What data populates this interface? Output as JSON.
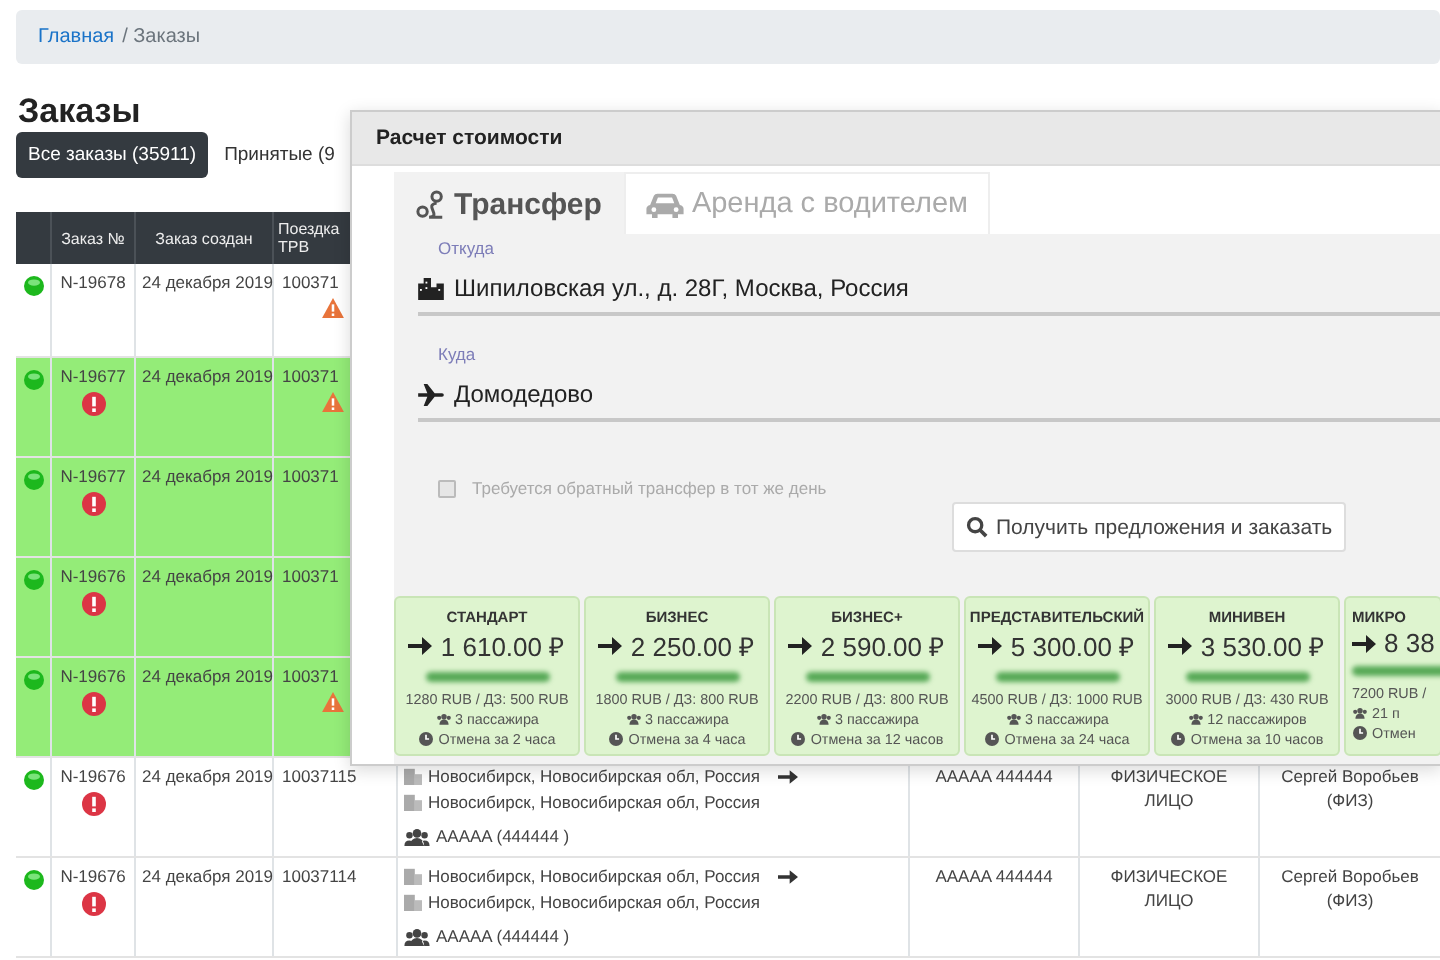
{
  "breadcrumb": [
    {
      "label": "Главная",
      "link": true
    },
    {
      "label": "/ Заказы",
      "link": false
    }
  ],
  "heading": "Заказы",
  "tabs": [
    {
      "label": "Все заказы (35911)",
      "selected": true
    },
    {
      "label": "Принятые (9",
      "selected": false
    }
  ],
  "table": {
    "columns": [
      "Заказ №",
      "Заказ создан",
      "Поездка ТРВ"
    ],
    "rows": [
      {
        "number": "N-19678",
        "date": "24 декабря 2019",
        "trip": "100371",
        "alert": false,
        "warning": true,
        "highlighted": false
      },
      {
        "number": "N-19677",
        "date": "24 декабря 2019",
        "trip": "100371",
        "alert": true,
        "warning": true,
        "highlighted": true
      },
      {
        "number": "N-19677",
        "date": "24 декабря 2019",
        "trip": "100371",
        "alert": true,
        "warning": false,
        "highlighted": true
      },
      {
        "number": "N-19676",
        "date": "24 декабря 2019",
        "trip": "100371",
        "alert": true,
        "warning": false,
        "highlighted": true
      },
      {
        "number": "N-19676",
        "date": "24 декабря 2019",
        "trip": "100371",
        "alert": true,
        "warning": true,
        "highlighted": true
      },
      {
        "number": "N-19676",
        "date": "24 декабря 2019",
        "trip": "10037115",
        "alert": true,
        "warning": false,
        "highlighted": false,
        "route": {
          "from": "Новосибирск, Новосибирская обл, Россия",
          "to": "Новосибирск, Новосибирская обл, Россия",
          "passenger": "AAAAA (444444 )"
        },
        "document": "AAAAA 444444",
        "customer_type": "ФИЗИЧЕСКОЕ ЛИЦО",
        "client": "Сергей Воробьев (ФИЗ)"
      },
      {
        "number": "N-19676",
        "date": "24 декабря 2019",
        "trip": "10037114",
        "alert": true,
        "warning": false,
        "highlighted": false,
        "route": {
          "from": "Новосибирск, Новосибирская обл, Россия",
          "to": "Новосибирск, Новосибирская обл, Россия",
          "passenger": "AAAAA (444444 )"
        },
        "document": "AAAAA 444444",
        "customer_type": "ФИЗИЧЕСКОЕ ЛИЦО",
        "client": "Сергей Воробьев (ФИЗ)"
      }
    ]
  },
  "dialog": {
    "title": "Расчет стоимости",
    "tabs": [
      {
        "label": "Трансфер",
        "selected": true
      },
      {
        "label": "Аренда с водителем",
        "selected": false
      }
    ],
    "fields": [
      {
        "label": "Откуда",
        "value": "Шипиловская ул., д. 28Г, Москва, Россия"
      },
      {
        "label": "Куда",
        "value": "Домодедово"
      }
    ],
    "return_trip": {
      "label": "Требуется обратный трансфер в тот же день",
      "checked": false
    },
    "submit": "Получить предложения и заказать",
    "offers": [
      {
        "title": "СТАНДАРТ",
        "price": "1 610.00 ₽",
        "rate": "1280 RUB / ДЗ: 500 RUB",
        "passengers": "3 пассажира",
        "cancel": "Отмена за 2 часа"
      },
      {
        "title": "БИЗНЕС",
        "price": "2 250.00 ₽",
        "rate": "1800 RUB / ДЗ: 800 RUB",
        "passengers": "3 пассажира",
        "cancel": "Отмена за 4 часа"
      },
      {
        "title": "БИЗНЕС+",
        "price": "2 590.00 ₽",
        "rate": "2200 RUB / ДЗ: 800 RUB",
        "passengers": "3 пассажира",
        "cancel": "Отмена за 12 часов"
      },
      {
        "title": "ПРЕДСТАВИТЕЛЬСКИЙ",
        "price": "5 300.00 ₽",
        "rate": "4500 RUB / ДЗ: 1000 RUB",
        "passengers": "3 пассажира",
        "cancel": "Отмена за 24 часа"
      },
      {
        "title": "МИНИВЕН",
        "price": "3 530.00 ₽",
        "rate": "3000 RUB / ДЗ: 430 RUB",
        "passengers": "12 пассажиров",
        "cancel": "Отмена за 10 часов"
      },
      {
        "title": "МИКРО",
        "price": "8 38",
        "rate": "7200 RUB /",
        "passengers": "21 п",
        "cancel": "Отмен"
      }
    ]
  }
}
